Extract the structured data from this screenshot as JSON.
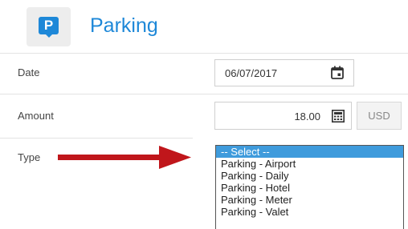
{
  "header": {
    "icon_letter": "P",
    "title": "Parking"
  },
  "form": {
    "date": {
      "label": "Date",
      "value": "06/07/2017"
    },
    "amount": {
      "label": "Amount",
      "value": "18.00",
      "currency": "USD"
    },
    "type": {
      "label": "Type",
      "options": [
        "-- Select --",
        "Parking - Airport",
        "Parking - Daily",
        "Parking - Hotel",
        "Parking - Meter",
        "Parking - Valet"
      ],
      "selected_option": "-- Select --"
    }
  },
  "annotation": {
    "arrow_color": "#c0161b"
  },
  "colors": {
    "accent": "#1e88d8",
    "selection": "#3f9bdc"
  }
}
